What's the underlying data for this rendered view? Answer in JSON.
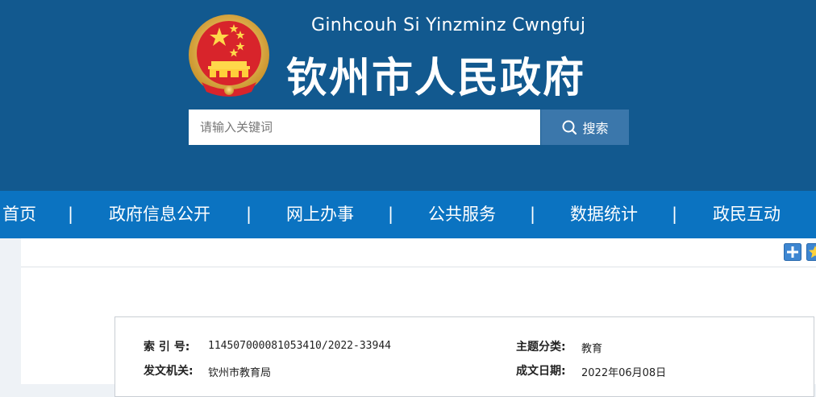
{
  "header": {
    "pinyin_name": "Ginhcouh Si Yinzminz Cwngfuj",
    "title": "钦州市人民政府",
    "emblem_icon": "national-emblem-icon",
    "bg_color": "#12598f"
  },
  "search": {
    "placeholder": "请输入关键词",
    "value": "",
    "button_label": "搜索",
    "button_icon": "search-icon",
    "button_color": "#3b77ab"
  },
  "nav": {
    "bg_color": "#0b73c1",
    "items": [
      {
        "label": "首页"
      },
      {
        "label": "政府信息公开"
      },
      {
        "label": "网上办事"
      },
      {
        "label": "公共服务"
      },
      {
        "label": "数据统计"
      },
      {
        "label": "政民互动"
      }
    ],
    "separator": "|"
  },
  "toolbar": {
    "add_icon": "plus-icon",
    "favorite_icon": "star-icon"
  },
  "document_info": {
    "index_no_label": "索 引 号:",
    "index_no_value": "114507000081053410/2022-33944",
    "topic_label": "主题分类:",
    "topic_value": "教育",
    "issuer_label": "发文机关:",
    "issuer_value": "钦州市教育局",
    "date_label": "成文日期:",
    "date_value": "2022年06月08日"
  }
}
